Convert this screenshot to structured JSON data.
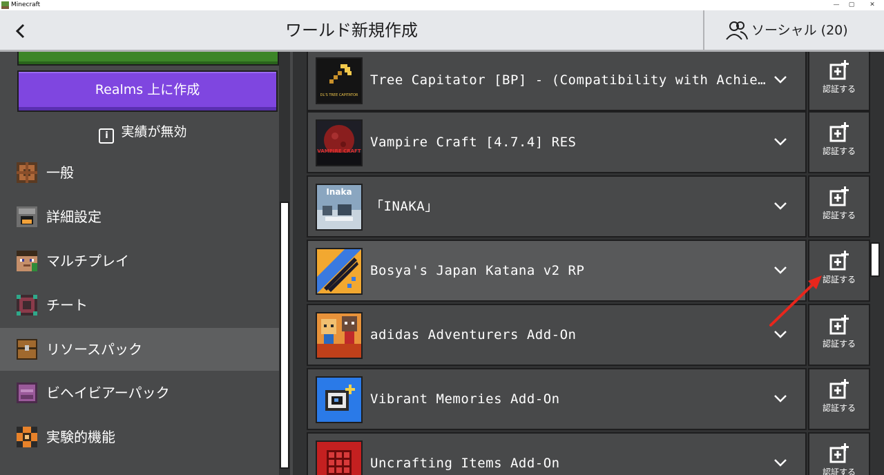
{
  "window": {
    "title": "Minecraft"
  },
  "header": {
    "title": "ワールド新規作成",
    "social_label": "ソーシャル (20)"
  },
  "left_panel": {
    "realms_button": "Realms 上に作成",
    "achievements_notice": "実績が無効",
    "nav": [
      {
        "label": "一般",
        "icon": "gear-block-icon",
        "active": false
      },
      {
        "label": "詳細設定",
        "icon": "furnace-icon",
        "active": false
      },
      {
        "label": "マルチプレイ",
        "icon": "steve-face-icon",
        "active": false
      },
      {
        "label": "チート",
        "icon": "command-block-icon",
        "active": false
      },
      {
        "label": "リソースパック",
        "icon": "chest-icon",
        "active": true
      },
      {
        "label": "ビヘイビアーパック",
        "icon": "behavior-pack-icon",
        "active": false
      },
      {
        "label": "実験的機能",
        "icon": "experimental-icon",
        "active": false
      }
    ]
  },
  "packs": [
    {
      "name": "Tree Capitator [BP] - (Compatibility with Achievements...",
      "thumb_text": "DL'S TREE CAPITATOR",
      "verify_label": "認証する"
    },
    {
      "name": "Vampire Craft [4.7.4] RES",
      "thumb_text": "VAMPIRE CRAFT",
      "verify_label": "認証する"
    },
    {
      "name": "「INAKA」",
      "thumb_text": "Inaka",
      "verify_label": "認証する"
    },
    {
      "name": "Bosya's Japan Katana v2 RP",
      "thumb_text": "",
      "verify_label": "認証する"
    },
    {
      "name": "adidas Adventurers Add-On",
      "thumb_text": "",
      "verify_label": "認証する"
    },
    {
      "name": "Vibrant Memories Add-On",
      "thumb_text": "",
      "verify_label": "認証する"
    },
    {
      "name": "Uncrafting Items Add-On",
      "thumb_text": "",
      "verify_label": "認証する"
    }
  ],
  "colors": {
    "accent_purple": "#7f46e0",
    "accent_green": "#3c8527",
    "annotation_red": "#e8261c"
  }
}
